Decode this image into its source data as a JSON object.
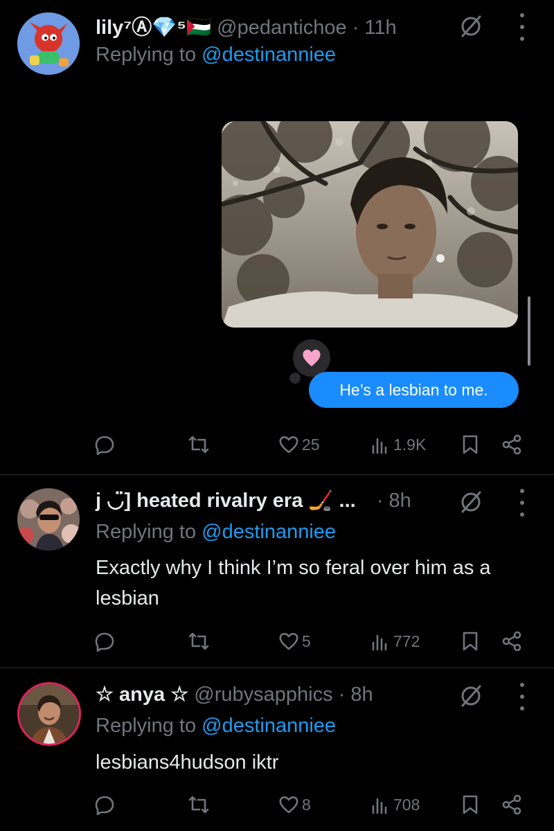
{
  "tweets": [
    {
      "display_name": "lily⁷Ⓐ💎⁵🇵🇸",
      "handle": "@pedantichoe",
      "time": "· 11h",
      "replying_prefix": "Replying to",
      "replying_to": "@destinanniee",
      "text": "",
      "message_bubble": "He’s a lesbian to me.",
      "reaction": "🩷",
      "replies": "",
      "retweets": "",
      "likes": "25",
      "views": "1.9K"
    },
    {
      "display_name": "j ◡̈] heated rivalry era 🏒 ...",
      "handle": "",
      "time": "· 8h",
      "replying_prefix": "Replying to",
      "replying_to": "@destinanniee",
      "text": "Exactly why I think I’m so feral over him as a lesbian",
      "replies": "",
      "retweets": "",
      "likes": "5",
      "views": "772"
    },
    {
      "display_name": "☆ anya ☆",
      "handle": "@rubysapphics",
      "time": "· 8h",
      "replying_prefix": "Replying to",
      "replying_to": "@destinanniee",
      "text": "lesbians4hudson iktr",
      "replies": "",
      "retweets": "",
      "likes": "8",
      "views": "708"
    }
  ],
  "colors": {
    "background": "#000000",
    "text": "#e7e9ea",
    "muted": "#71767b",
    "link": "#1d9bf0",
    "imessage_blue": "#1a8cff",
    "divider": "#2f3336"
  },
  "icons": [
    "reply-icon",
    "retweet-icon",
    "like-icon",
    "views-icon",
    "bookmark-icon",
    "share-icon",
    "grok-icon",
    "more-icon"
  ]
}
